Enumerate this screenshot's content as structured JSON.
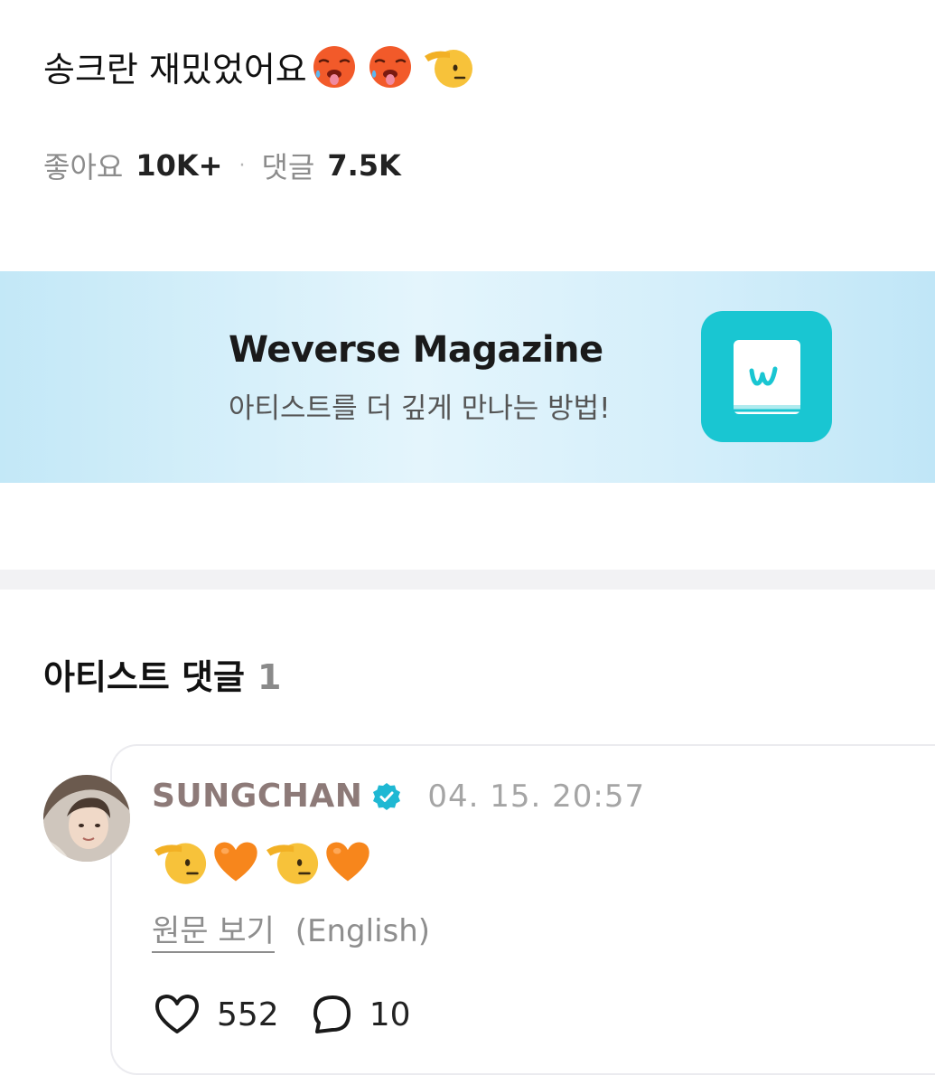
{
  "post": {
    "text": "송크란 재밌었어요",
    "emojis": [
      "hot-face-emoji",
      "hot-face-emoji",
      "saluting-face-emoji"
    ],
    "stats": {
      "likes_label": "좋아요",
      "likes_value": "10K+",
      "separator": "·",
      "comments_label": "댓글",
      "comments_value": "7.5K"
    }
  },
  "banner": {
    "title": "Weverse Magazine",
    "subtitle": "아티스트를 더 깊게 만나는 방법!",
    "logo_icon": "weverse-magazine-book-icon",
    "logo_color": "#19c6d2"
  },
  "artist_comments": {
    "title": "아티스트 댓글",
    "count": "1",
    "items": [
      {
        "author": "SUNGCHAN",
        "author_color": "#8d7a78",
        "verified_icon": "verified-badge-icon",
        "verified_color": "#1fb8d3",
        "timestamp": "04. 15. 20:57",
        "body_emojis": [
          "saluting-face-emoji",
          "orange-heart-emoji",
          "saluting-face-emoji",
          "orange-heart-emoji"
        ],
        "translate_label": "원문 보기",
        "translate_lang": "(English)",
        "likes": "552",
        "replies": "10"
      }
    ]
  }
}
